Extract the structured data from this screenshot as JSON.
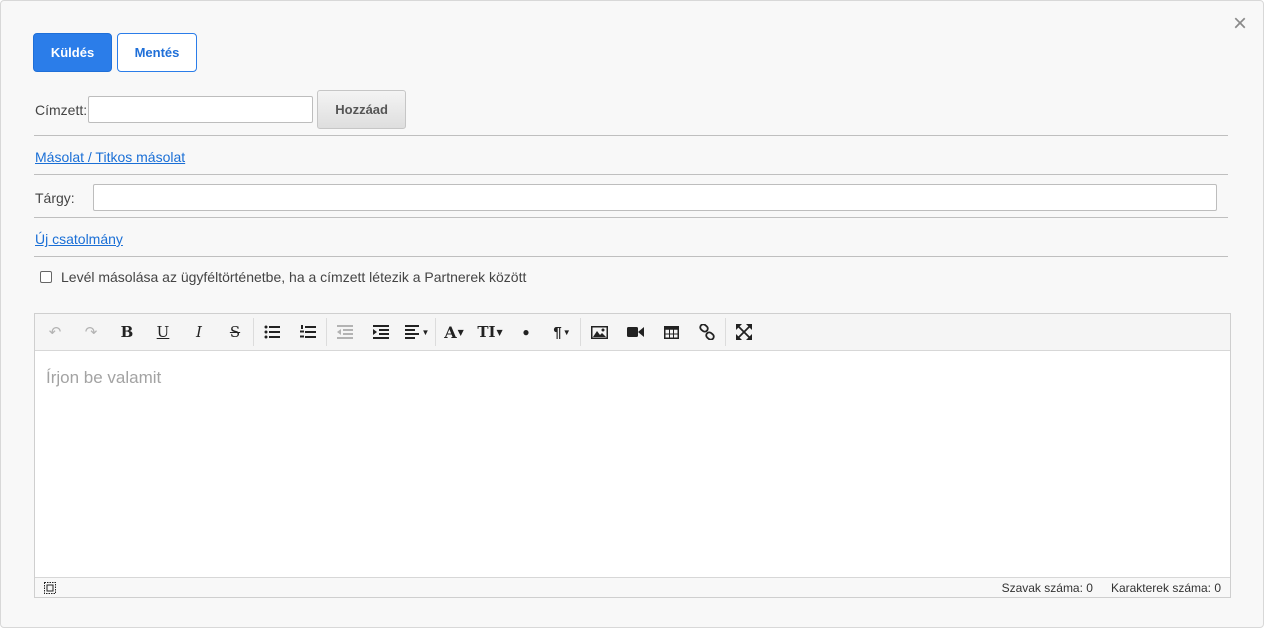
{
  "actions": {
    "send_label": "Küldés",
    "save_label": "Mentés"
  },
  "recipient": {
    "label": "Címzett:",
    "value": "",
    "add_label": "Hozzáad"
  },
  "cc_link": "Másolat / Titkos másolat",
  "subject": {
    "label": "Tárgy:",
    "value": ""
  },
  "attachment_link": "Új csatolmány",
  "copy_history": {
    "label": "Levél másolása az ügyféltörténetbe, ha a címzett létezik a Partnerek között",
    "checked": false
  },
  "editor": {
    "placeholder": "Írjon be valamit",
    "toolbar": {
      "undo": "↶",
      "redo": "↷",
      "bold": "B",
      "underline": "U",
      "italic": "I",
      "strike": "S",
      "font_color": "A",
      "font_size": "TI",
      "color_fill": "●",
      "paragraph": "¶"
    },
    "word_count_label": "Szavak száma: 0",
    "char_count_label": "Karakterek száma: 0"
  }
}
